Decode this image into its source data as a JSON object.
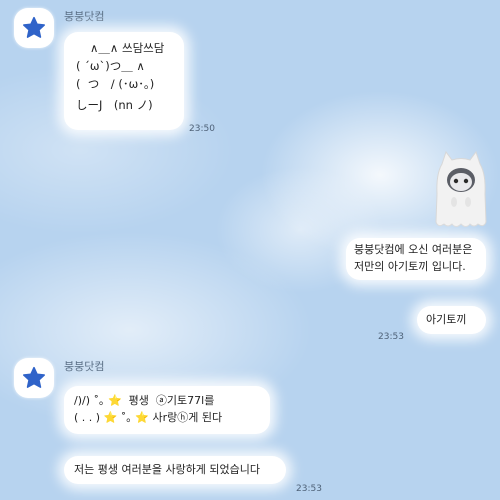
{
  "colors": {
    "background": "#b7d3ef",
    "bubble": "#ffffff",
    "star": "#2f63c9"
  },
  "messages": [
    {
      "sender": "붕붕닷컴",
      "lines": [
        "∧＿∧ 쓰담쓰담",
        "( ´ω`)つ＿ ∧",
        "(  つ　/ (･ω･｡)",
        "しーJ　(nn ノ)"
      ],
      "time": "23:50"
    },
    {
      "sticker": "ghost-doll-sticker",
      "lines": [
        "붕붕닷컴에 오신 여러분은",
        "저만의 아기토끼 입니다."
      ]
    },
    {
      "lines": [
        "아기토끼"
      ],
      "time": "23:53"
    },
    {
      "sender": "붕붕닷컴",
      "lines": [
        "/)/) ˚｡ ⭐  평생  ⓐ기토77l를",
        "( . . ) ⭐ ˚｡ ⭐ 사r랑ⓗ게 된다"
      ],
      "time": "23:53"
    },
    {
      "lines": [
        "저는 평생 여러분을 사랑하게 되었습니다"
      ]
    }
  ]
}
